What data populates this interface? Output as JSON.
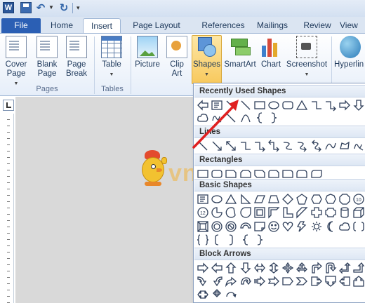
{
  "app": {
    "logo_letter": "W",
    "icons": [
      "word-logo",
      "save-icon",
      "undo-icon",
      "redo-icon"
    ]
  },
  "tabs": [
    {
      "label": "File"
    },
    {
      "label": "Home"
    },
    {
      "label": "Insert",
      "active": true
    },
    {
      "label": "Page Layout"
    },
    {
      "label": "References"
    },
    {
      "label": "Mailings"
    },
    {
      "label": "Review"
    },
    {
      "label": "View"
    }
  ],
  "ribbon": {
    "cover_page": "Cover Page",
    "blank_page": "Blank Page",
    "page_break": "Page Break",
    "pages_group": "Pages",
    "table": "Table",
    "tables_group": "Tables",
    "picture": "Picture",
    "clip_art": "Clip Art",
    "shapes": "Shapes",
    "smartart": "SmartArt",
    "chart": "Chart",
    "screenshot": "Screenshot",
    "hyperlink": "Hyperlin"
  },
  "gallery": {
    "sections": [
      {
        "title": "Recently Used Shapes"
      },
      {
        "title": "Lines"
      },
      {
        "title": "Rectangles"
      },
      {
        "title": "Basic Shapes"
      },
      {
        "title": "Block Arrows"
      }
    ]
  },
  "watermark": {
    "text": "vndoo"
  },
  "colors": {
    "file_tab": "#2b5fb4",
    "shapes_highlight": "#f8c95d",
    "annotation_arrow": "#e02020"
  }
}
